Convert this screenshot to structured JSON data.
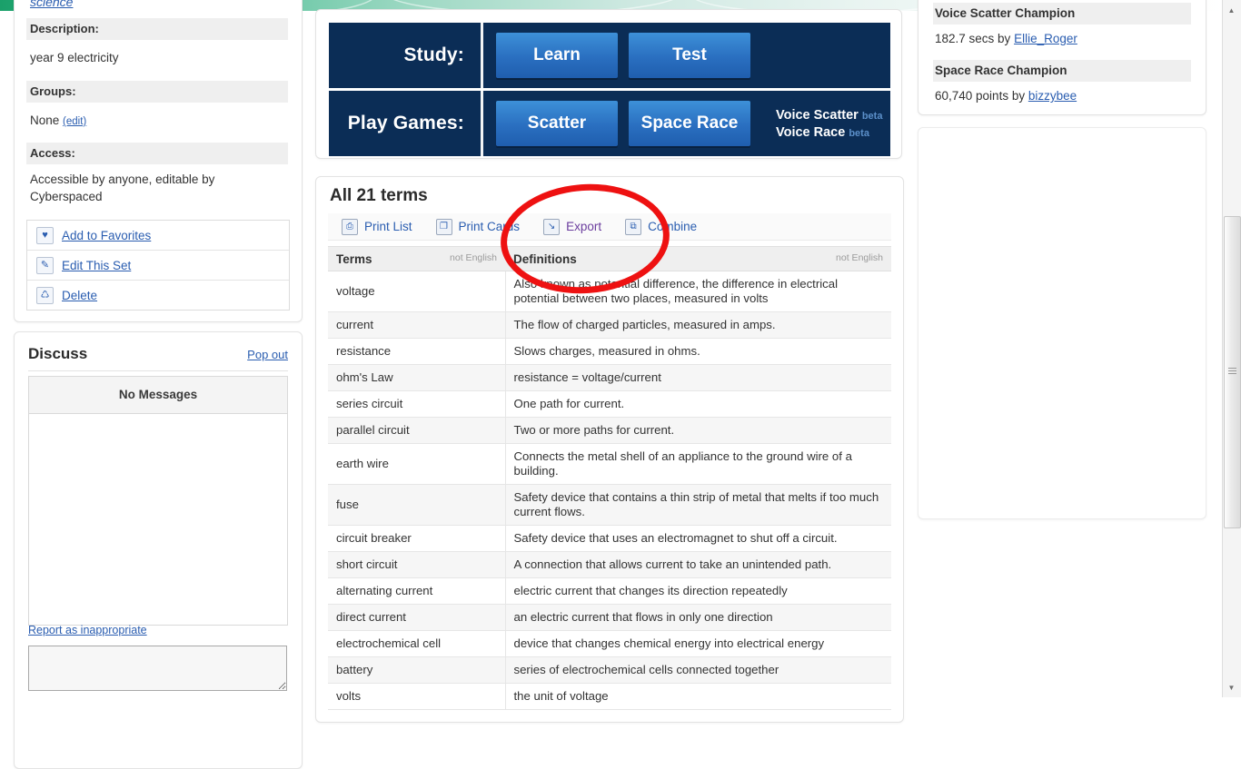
{
  "sidebar": {
    "category_link": "science",
    "sections": [
      {
        "heading": "Description:",
        "body": "year 9 electricity"
      },
      {
        "heading": "Groups:",
        "body": "None",
        "link": "(edit)"
      },
      {
        "heading": "Access:",
        "body": "Accessible by anyone, editable by Cyberspaced"
      }
    ],
    "actions": [
      {
        "label": "Add to Favorites",
        "icon": "heart-icon",
        "glyph": "♥"
      },
      {
        "label": "Edit This Set",
        "icon": "pencil-icon",
        "glyph": "✎"
      },
      {
        "label": "Delete",
        "icon": "trash-icon",
        "glyph": "Ὕ1"
      }
    ],
    "discuss": {
      "title": "Discuss",
      "popout": "Pop out",
      "no_messages": "No Messages",
      "report": "Report as inappropriate",
      "input_value": "",
      "input_placeholder": ""
    }
  },
  "study": {
    "rows": [
      {
        "label": "Study:",
        "buttons": [
          "Learn",
          "Test"
        ],
        "extras": []
      },
      {
        "label": "Play Games:",
        "buttons": [
          "Scatter",
          "Space Race"
        ],
        "extras": [
          {
            "name": "Voice Scatter",
            "tag": "beta"
          },
          {
            "name": "Voice Race",
            "tag": "beta"
          }
        ]
      }
    ]
  },
  "terms": {
    "title": "All 21 terms",
    "toolbar": [
      {
        "label": "Print List",
        "icon": "printer-icon",
        "glyph": "⎙",
        "visited": false
      },
      {
        "label": "Print Cards",
        "icon": "cards-icon",
        "glyph": "❐",
        "visited": false
      },
      {
        "label": "Export",
        "icon": "export-icon",
        "glyph": "↘",
        "visited": true
      },
      {
        "label": "Combine",
        "icon": "combine-icon",
        "glyph": "⧉",
        "visited": false
      }
    ],
    "columns": [
      {
        "label": "Terms",
        "note": "not English"
      },
      {
        "label": "Definitions",
        "note": "not English"
      }
    ],
    "rows": [
      {
        "term": "voltage",
        "definition": "Also known as potential difference, the difference in electrical potential between two places, measured in volts"
      },
      {
        "term": "current",
        "definition": "The flow of charged particles, measured in amps."
      },
      {
        "term": "resistance",
        "definition": "Slows charges, measured in ohms."
      },
      {
        "term": "ohm's Law",
        "definition": "resistance = voltage/current"
      },
      {
        "term": "series circuit",
        "definition": "One path for current."
      },
      {
        "term": "parallel circuit",
        "definition": "Two or more paths for current."
      },
      {
        "term": "earth wire",
        "definition": "Connects the metal shell of an appliance to the ground wire of a building."
      },
      {
        "term": "fuse",
        "definition": "Safety device that contains a thin strip of metal that melts if too much current flows."
      },
      {
        "term": "circuit breaker",
        "definition": "Safety device that uses an electromagnet to shut off a circuit."
      },
      {
        "term": "short circuit",
        "definition": "A connection that allows current to take an unintended path."
      },
      {
        "term": "alternating current",
        "definition": "electric current that changes its direction repeatedly"
      },
      {
        "term": "direct current",
        "definition": "an electric current that flows in only one direction"
      },
      {
        "term": "electrochemical cell",
        "definition": "device that changes chemical energy into electrical energy"
      },
      {
        "term": "battery",
        "definition": "series of electrochemical cells connected together"
      },
      {
        "term": "volts",
        "definition": "the unit of voltage"
      }
    ]
  },
  "champions": [
    {
      "heading": "Voice Scatter Champion",
      "value": "182.7 secs by ",
      "user": "Ellie_Roger"
    },
    {
      "heading": "Space Race Champion",
      "value": "60,740 points by ",
      "user": "bizzybee"
    }
  ],
  "annotation": {
    "shape": "ellipse",
    "color": "#ee1111",
    "targets": "Export"
  },
  "colors": {
    "link": "#2a5db0",
    "visited_link": "#6b3d9e",
    "study_panel_bg": "#0b2d56",
    "button_blue": "#2a6fc0",
    "annotation_red": "#ee1111",
    "banner_green": "#1aa06a"
  }
}
